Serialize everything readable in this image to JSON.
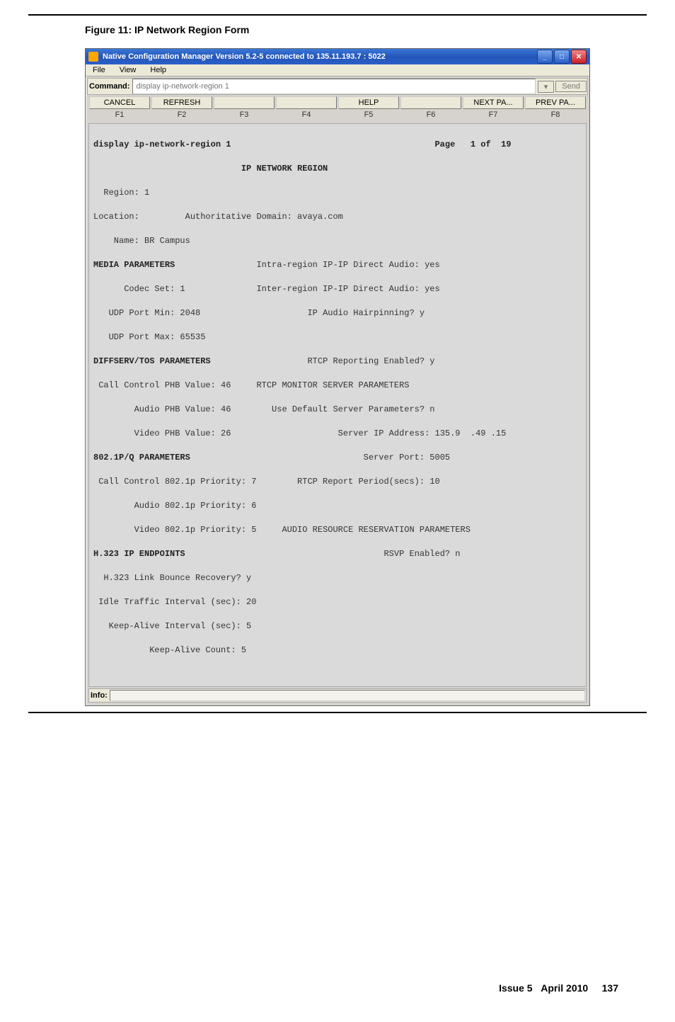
{
  "figure_caption": "Figure 11: IP Network Region Form",
  "window_title": "Native Configuration Manager Version 5.2-5 connected to 135.11.193.7 : 5022",
  "menus": [
    "File",
    "View",
    "Help"
  ],
  "command": {
    "label": "Command:",
    "placeholder": "display ip-network-region 1",
    "send": "Send",
    "dd": "▾"
  },
  "action_buttons": [
    "CANCEL",
    "REFRESH",
    "",
    "",
    "HELP",
    "",
    "NEXT  PA...",
    "PREV  PA..."
  ],
  "fkeys": [
    "F1",
    "F2",
    "F3",
    "F4",
    "F5",
    "F6",
    "F7",
    "F8"
  ],
  "term": {
    "l1a": "display ip-network-region 1",
    "l1b": "Page   1 of  19",
    "l2": "                             IP NETWORK REGION",
    "l3": "  Region: 1",
    "l4": "Location:         Authoritative Domain: avaya.com",
    "l5": "    Name: BR Campus",
    "l6a": "MEDIA PARAMETERS",
    "l6b": "Intra-region IP-IP Direct Audio: yes",
    "l7a": "      Codec Set: 1",
    "l7b": "Inter-region IP-IP Direct Audio: yes",
    "l8a": "   UDP Port Min: 2048",
    "l8b": "IP Audio Hairpinning? y",
    "l9": "   UDP Port Max: 65535",
    "l10a": "DIFFSERV/TOS PARAMETERS",
    "l10b": "RTCP Reporting Enabled? y",
    "l11a": " Call Control PHB Value: 46",
    "l11b": "RTCP MONITOR SERVER PARAMETERS",
    "l12a": "        Audio PHB Value: 46",
    "l12b": "Use Default Server Parameters? n",
    "l13a": "        Video PHB Value: 26",
    "l13b": "Server IP Address: 135.9  .49 .15",
    "l14a": "802.1P/Q PARAMETERS",
    "l14b": "Server Port: 5005",
    "l15a": " Call Control 802.1p Priority: 7",
    "l15b": "RTCP Report Period(secs): 10",
    "l16": "        Audio 802.1p Priority: 6",
    "l17a": "        Video 802.1p Priority: 5",
    "l17b": "AUDIO RESOURCE RESERVATION PARAMETERS",
    "l18a": "H.323 IP ENDPOINTS",
    "l18b": "RSVP Enabled? n",
    "l19": "  H.323 Link Bounce Recovery? y",
    "l20": " Idle Traffic Interval (sec): 20",
    "l21": "   Keep-Alive Interval (sec): 5",
    "l22": "           Keep-Alive Count: 5"
  },
  "info_label": "Info:",
  "footer": {
    "issue": "Issue 5",
    "date": "April 2010",
    "page": "137"
  }
}
